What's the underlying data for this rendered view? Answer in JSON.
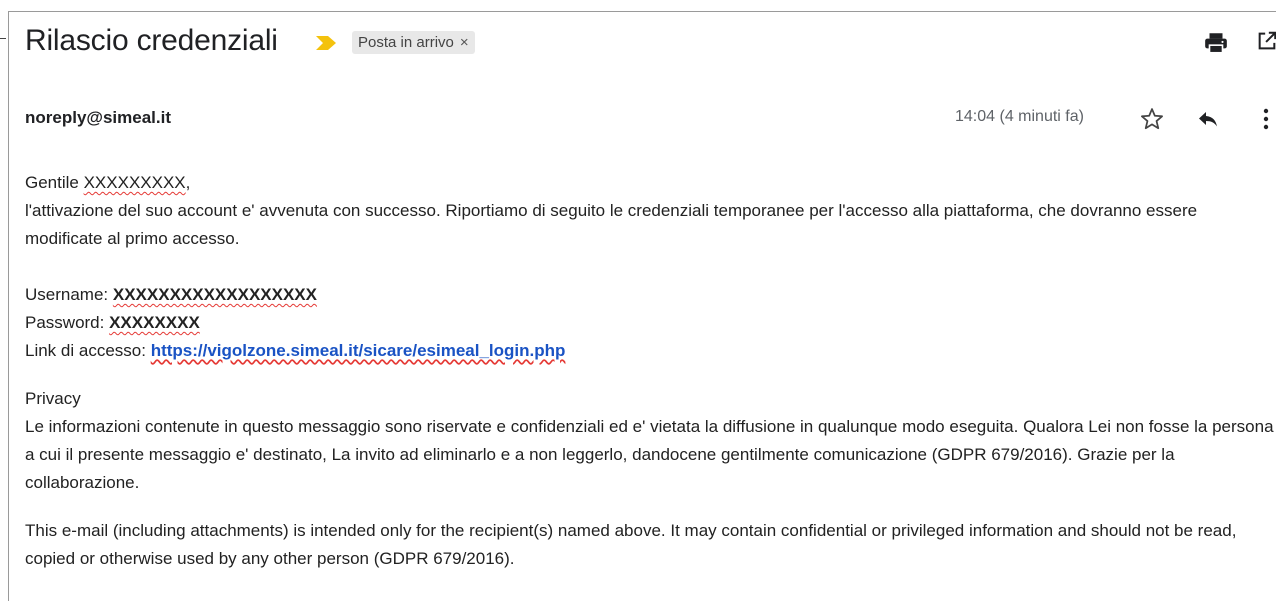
{
  "header": {
    "subject": "Rilascio credenziali",
    "label": "Posta in arrivo",
    "label_remove": "×",
    "importance_color": "#f4c20d"
  },
  "message": {
    "sender": "noreply@simeal.it",
    "time": "14:04 (4 minuti fa)"
  },
  "icons": {
    "print": "print-icon",
    "open_new_window": "open-in-new-window-icon",
    "star": "star-icon",
    "reply": "reply-icon",
    "more": "more-vertical-icon"
  },
  "body": {
    "greeting_prefix": "Gentile ",
    "greeting_name": "XXXXXXXXX",
    "greeting_suffix": ",",
    "intro": "l'attivazione del suo account e' avvenuta con successo. Riportiamo di seguito le credenziali temporanee per l'accesso alla piattaforma, che dovranno essere modificate al primo accesso.",
    "username_label": "Username: ",
    "username_value": "XXXXXXXXXXXXXXXXXX",
    "password_label": "Password: ",
    "password_value": "XXXXXXXX",
    "link_label": "Link di accesso: ",
    "link_url": "https://vigolzone.simeal.it/sicare/esimeal_login.php",
    "privacy_title": "Privacy",
    "privacy_it": "Le informazioni contenute in questo messaggio sono riservate e confidenziali ed e' vietata la diffusione in qualunque modo eseguita. Qualora Lei non fosse la persona a cui il presente messaggio e' destinato, La invito ad eliminarlo e a non leggerlo, dandocene gentilmente comunicazione (GDPR 679/2016). Grazie per la collaborazione.",
    "privacy_en": "This e-mail (including attachments) is intended only for the recipient(s) named above. It may contain confidential or privileged information and should not be read, copied or otherwise used by any other person (GDPR 679/2016)."
  }
}
